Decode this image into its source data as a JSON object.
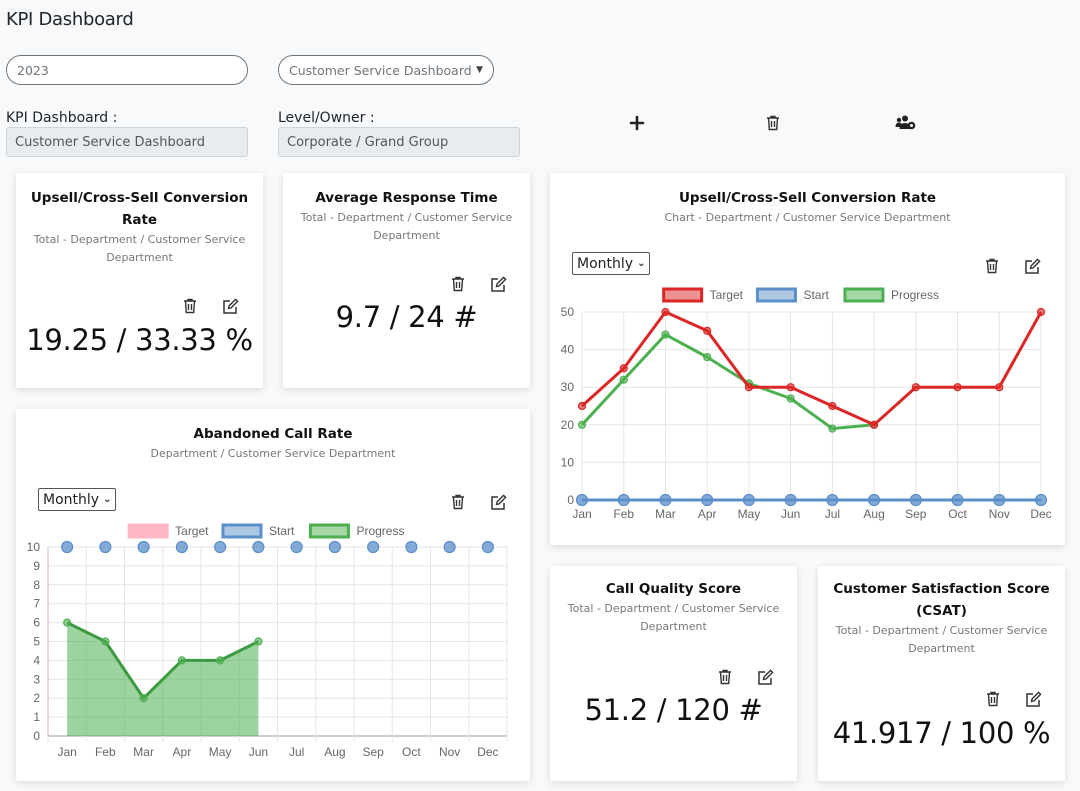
{
  "page": {
    "title": "KPI Dashboard"
  },
  "filters": {
    "year_input": {
      "value": "2023",
      "placeholder": "2023"
    },
    "dashboard_select": {
      "selected": "Customer Service Dashboard"
    }
  },
  "info": {
    "kpi_dashboard_label": "KPI Dashboard :",
    "kpi_dashboard_value": "Customer Service Dashboard",
    "level_owner_label": "Level/Owner :",
    "level_owner_value": "Corporate / Grand Group"
  },
  "toolbar": {
    "add_icon": "plus-icon",
    "delete_icon": "trash-icon",
    "manage_icon": "users-gear-icon"
  },
  "cards": {
    "upsell_total": {
      "title": "Upsell/Cross-Sell Conversion Rate",
      "subtitle": "Total - Department / Customer Service Department",
      "value": "19.25 / 33.33 %"
    },
    "avg_response": {
      "title": "Average Response Time",
      "subtitle": "Total - Department / Customer Service Department",
      "value": "9.7 / 24 #"
    },
    "call_quality": {
      "title": "Call Quality Score",
      "subtitle": "Total - Department / Customer Service Department",
      "value": "51.2 / 120 #"
    },
    "csat": {
      "title": "Customer Satisfaction Score (CSAT)",
      "subtitle": "Total - Department / Customer Service Department",
      "value": "41.917 / 100 %"
    },
    "upsell_chart": {
      "title": "Upsell/Cross-Sell Conversion Rate",
      "subtitle": "Chart - Department / Customer Service Department",
      "period": "Monthly"
    },
    "abandoned_chart": {
      "title": "Abandoned Call Rate",
      "subtitle": "Department / Customer Service Department",
      "period": "Monthly"
    }
  },
  "colors": {
    "target": "#dc2626",
    "start": "#5b8fc9",
    "progress": "#4caf50"
  },
  "chart_data": [
    {
      "type": "line",
      "title": "Upsell/Cross-Sell Conversion Rate",
      "categories": [
        "Jan",
        "Feb",
        "Mar",
        "Apr",
        "May",
        "Jun",
        "Jul",
        "Aug",
        "Sep",
        "Oct",
        "Nov",
        "Dec"
      ],
      "ylim": [
        0,
        50
      ],
      "yticks": [
        0,
        10,
        20,
        30,
        40,
        50
      ],
      "grid": true,
      "legend": "top-center",
      "series": [
        {
          "name": "Target",
          "values": [
            25,
            35,
            50,
            45,
            30,
            30,
            25,
            20,
            30,
            30,
            30,
            50
          ]
        },
        {
          "name": "Start",
          "values": [
            0,
            0,
            0,
            0,
            0,
            0,
            0,
            0,
            0,
            0,
            0,
            0
          ]
        },
        {
          "name": "Progress",
          "values": [
            20,
            32,
            44,
            38,
            31,
            27,
            19,
            20,
            null,
            null,
            null,
            null
          ]
        }
      ]
    },
    {
      "type": "area",
      "title": "Abandoned Call Rate",
      "categories": [
        "Jan",
        "Feb",
        "Mar",
        "Apr",
        "May",
        "Jun",
        "Jul",
        "Aug",
        "Sep",
        "Oct",
        "Nov",
        "Dec"
      ],
      "ylim": [
        0,
        10
      ],
      "yticks": [
        0,
        1,
        2,
        3,
        4,
        5,
        6,
        7,
        8,
        9,
        10
      ],
      "grid": true,
      "legend": "top-center",
      "series": [
        {
          "name": "Target",
          "values": [
            null,
            null,
            null,
            null,
            null,
            null,
            null,
            null,
            null,
            null,
            null,
            null
          ]
        },
        {
          "name": "Start",
          "values": [
            10,
            10,
            10,
            10,
            10,
            10,
            10,
            10,
            10,
            10,
            10,
            10
          ]
        },
        {
          "name": "Progress",
          "values": [
            6,
            5,
            2,
            4,
            4,
            5,
            null,
            null,
            null,
            null,
            null,
            null
          ]
        }
      ]
    }
  ]
}
